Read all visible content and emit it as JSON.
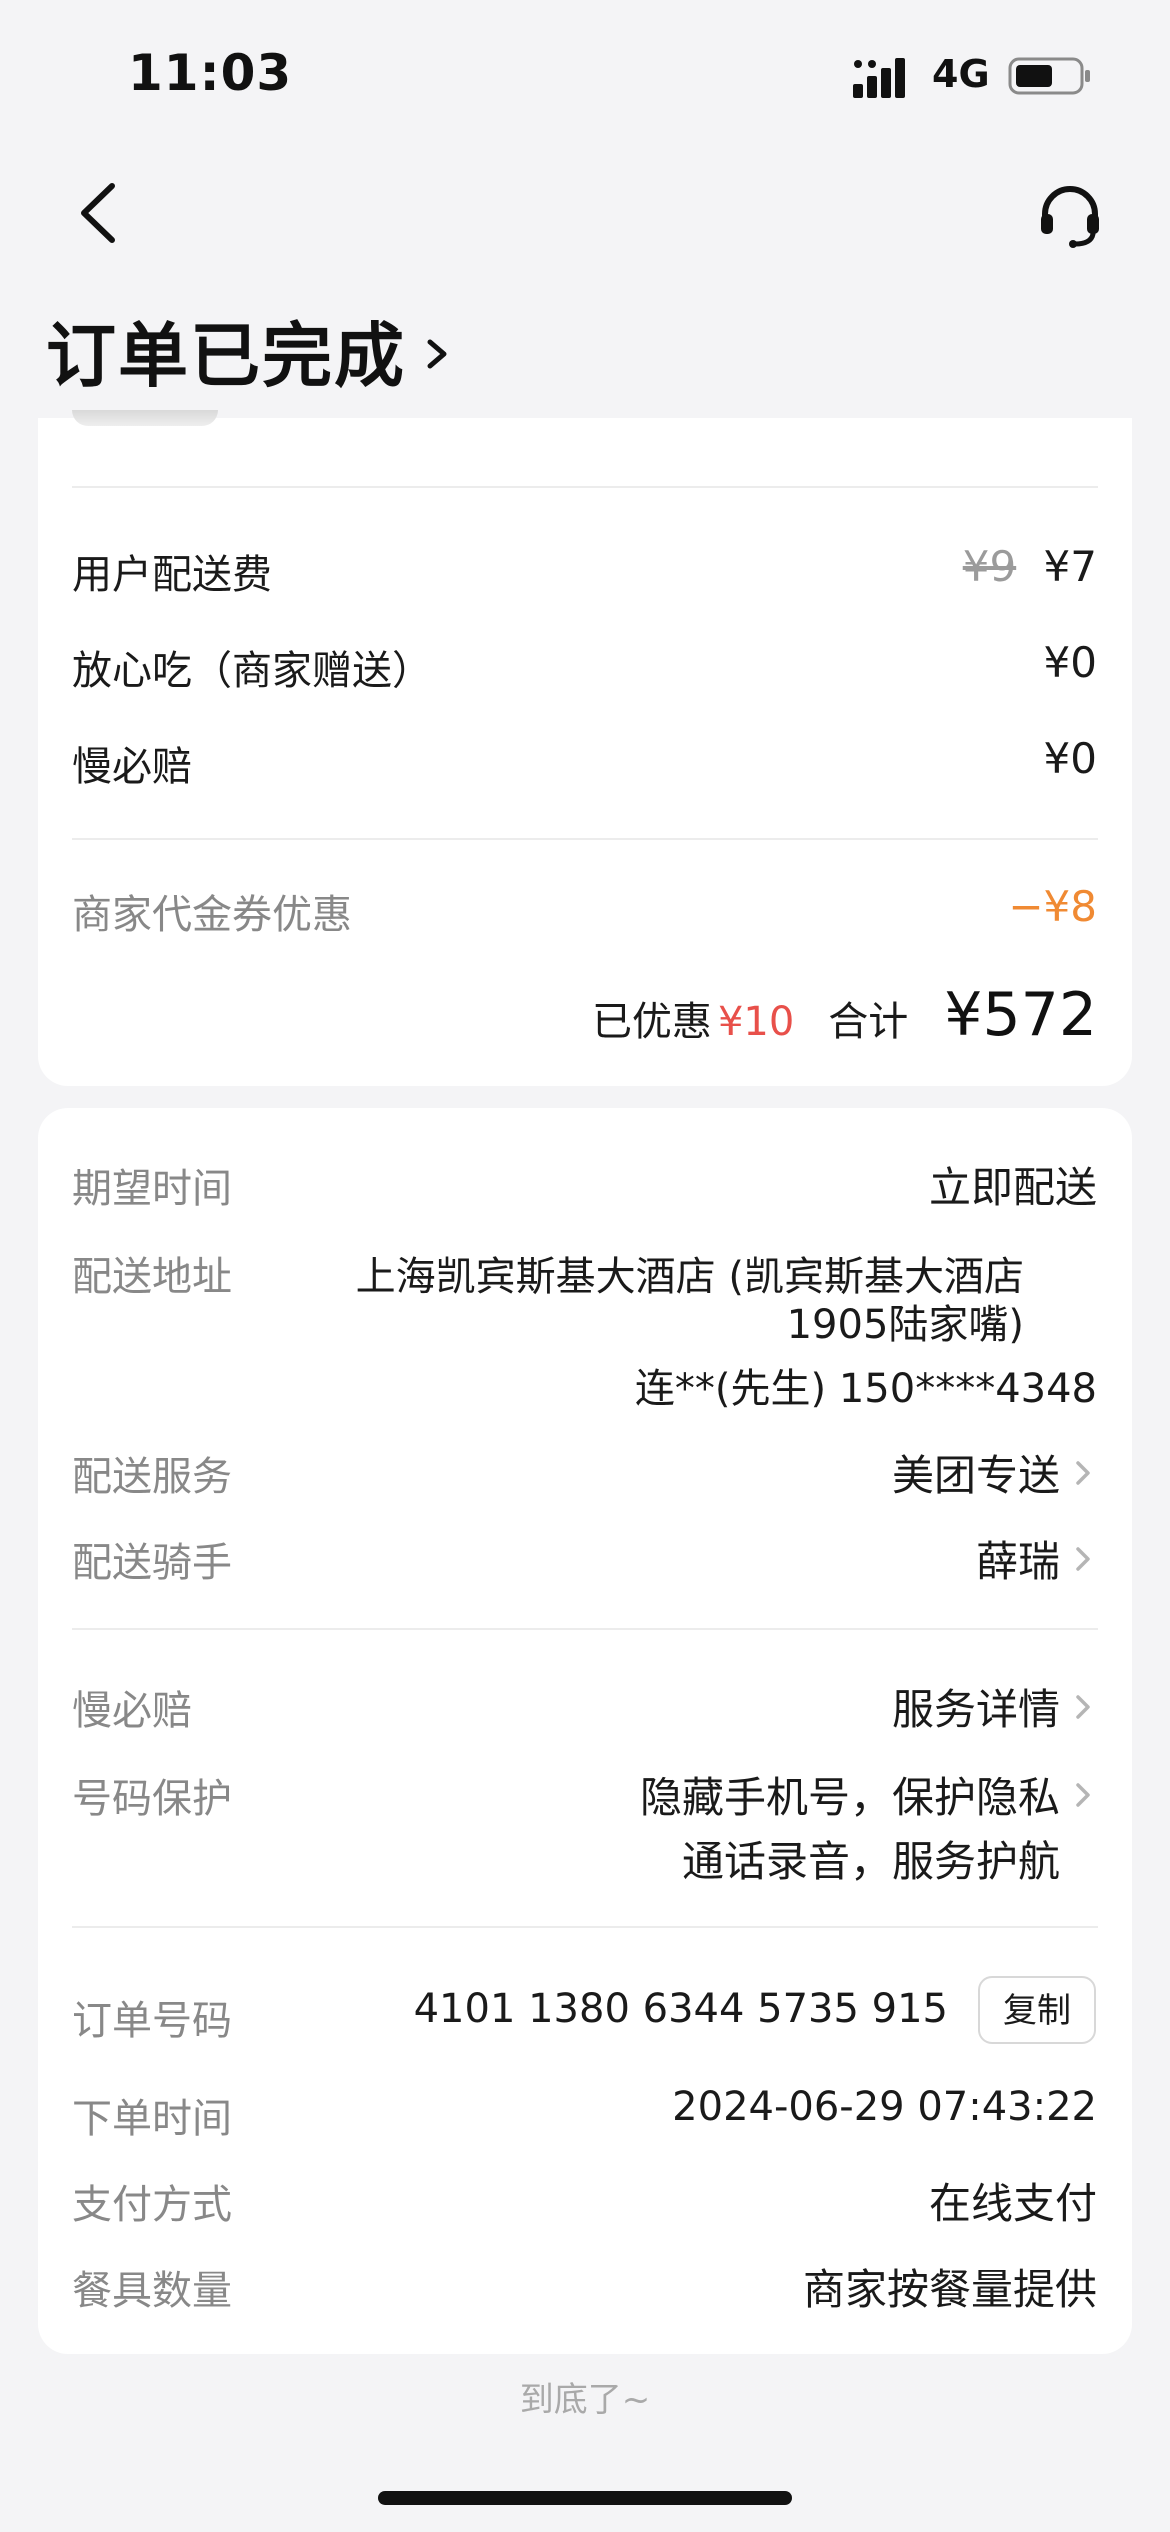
{
  "status_bar": {
    "time": "11:03",
    "network": "4G"
  },
  "header": {
    "title": "订单已完成"
  },
  "fees": {
    "delivery_label": "用户配送费",
    "delivery_original": "¥9",
    "delivery_price": "¥7",
    "assurance_label": "放心吃（商家赠送）",
    "assurance_price": "¥0",
    "late_comp_label": "慢必赔",
    "late_comp_price": "¥0",
    "voucher_label": "商家代金券优惠",
    "voucher_value": "−¥8",
    "saved_label": "已优惠",
    "saved_value": "¥10",
    "total_label": "合计",
    "total_value": "¥572"
  },
  "delivery": {
    "expected_label": "期望时间",
    "expected_value": "立即配送",
    "address_label": "配送地址",
    "address_line1": "上海凯宾斯基大酒店 (凯宾斯基大酒店",
    "address_line2": "1905陆家嘴)",
    "contact": "连**(先生) 150****4348",
    "service_label": "配送服务",
    "service_value": "美团专送",
    "rider_label": "配送骑手",
    "rider_value": "薛瑞"
  },
  "protection": {
    "late_label": "慢必赔",
    "late_value": "服务详情",
    "phone_label": "号码保护",
    "phone_value_line1": "隐藏手机号，保护隐私",
    "phone_value_line2": "通话录音，服务护航"
  },
  "order_info": {
    "number_label": "订单号码",
    "number_value": "4101 1380 6344 5735 915",
    "copy_label": "复制",
    "time_label": "下单时间",
    "time_value": "2024-06-29 07:43:22",
    "payment_label": "支付方式",
    "payment_value": "在线支付",
    "utensils_label": "餐具数量",
    "utensils_value": "商家按餐量提供"
  },
  "footer": {
    "tip": "到底了~"
  },
  "colors": {
    "accent_orange": "#f08a33",
    "discount_red": "#e8504a",
    "page_bg": "#f4f4f6"
  },
  "icons": {
    "back": "chevron-left-icon",
    "support": "headset-icon",
    "title_arrow": "chevron-right-icon",
    "signal": "signal-icon",
    "battery": "battery-icon"
  }
}
